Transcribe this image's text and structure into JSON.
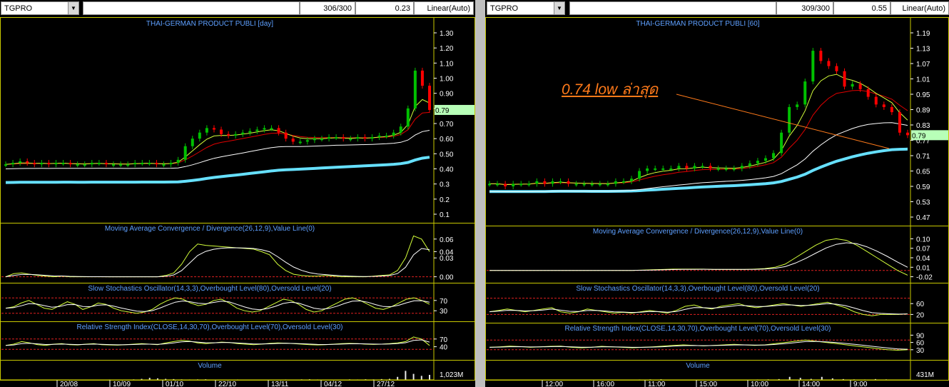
{
  "left": {
    "symbol": "TGPRO",
    "ratio": "306/300",
    "value": "0.23",
    "scale": "Linear(Auto)",
    "title": "THAI-GERMAN PRODUCT PUBLI [day]",
    "price_ticks": [
      "1.30",
      "1.20",
      "1.10",
      "1.00",
      "0.90",
      "0.80",
      "0.70",
      "0.60",
      "0.50",
      "0.40",
      "0.3",
      "0.2",
      "0.1"
    ],
    "last_price": "0.79",
    "macd_title": "Moving Average Convergence / Divergence(26,12,9),Value Line(0)",
    "macd_ticks": [
      "0.06",
      "0.04",
      "0.03",
      "0.00"
    ],
    "stoch_title": "Slow Stochastics Oscillator(14,3,3),Overbought Level(80),Oversold Level(20)",
    "stoch_ticks": [
      "70",
      "30"
    ],
    "rsi_title": "Relative Strength Index(CLOSE,14,30,70),Overbought Level(70),Oversold Level(30)",
    "rsi_ticks": [
      "70",
      "40"
    ],
    "volume_title": "Volume",
    "volume_tick": "1,023M",
    "x_labels": [
      "20/08",
      "10/09",
      "01/10",
      "22/10",
      "13/11",
      "04/12",
      "27/12"
    ]
  },
  "right": {
    "symbol": "TGPRO",
    "ratio": "309/300",
    "value": "0.55",
    "scale": "Linear(Auto)",
    "title": "THAI-GERMAN PRODUCT PUBLI [60]",
    "price_ticks": [
      "1.19",
      "1.13",
      "1.07",
      "1.01",
      "0.95",
      "0.89",
      "0.83",
      "0.77",
      "0.71",
      "0.65",
      "0.59",
      "0.53",
      "0.47"
    ],
    "last_price": "0.79",
    "annotation": "0.74  low ล่าสุด",
    "macd_title": "Moving Average Convergence / Divergence(26,12,9),Value Line(0)",
    "macd_ticks": [
      "0.10",
      "0.07",
      "0.04",
      "0.01",
      "-0.02"
    ],
    "stoch_title": "Slow Stochastics Oscillator(14,3,3),Overbought Level(80),Oversold Level(20)",
    "stoch_ticks": [
      "60",
      "20"
    ],
    "rsi_title": "Relative Strength Index(CLOSE,14,30,70),Overbought Level(70),Oversold Level(30)",
    "rsi_ticks": [
      "90",
      "60",
      "30"
    ],
    "volume_title": "Volume",
    "volume_tick": "431M",
    "x_labels": [
      "12:00",
      "16:00",
      "11:00",
      "15:00",
      "10:00",
      "14:00",
      "9:00"
    ]
  },
  "colors": {
    "panel_border": "#c8c800",
    "candle_up": "#00c000",
    "candle_down": "#ff0000",
    "ma_short": "#ffffff",
    "ma_mid": "#e00000",
    "ma_long": "#ffffff",
    "ma_thick": "#66e0ff",
    "signal": "#d4ff3a",
    "level_line": "#e02020",
    "title_text": "#5ea0ff",
    "last_price_bg": "#b8ffb8",
    "annotation": "#ff7a1a"
  },
  "chart_data": [
    {
      "type": "line",
      "title": "THAI-GERMAN PRODUCT PUBLI [day]",
      "x": [
        "20/08",
        "10/09",
        "01/10",
        "22/10",
        "13/11",
        "04/12",
        "27/12"
      ],
      "series": [],
      "ylim": [
        0.1,
        1.3
      ],
      "price_closes": [
        0.43,
        0.44,
        0.45,
        0.44,
        0.43,
        0.44,
        0.43,
        0.44,
        0.44,
        0.43,
        0.43,
        0.43,
        0.44,
        0.44,
        0.43,
        0.43,
        0.43,
        0.43,
        0.44,
        0.44,
        0.44,
        0.43,
        0.43,
        0.44,
        0.46,
        0.55,
        0.6,
        0.64,
        0.67,
        0.66,
        0.63,
        0.62,
        0.63,
        0.64,
        0.65,
        0.66,
        0.67,
        0.67,
        0.64,
        0.6,
        0.58,
        0.58,
        0.59,
        0.6,
        0.6,
        0.61,
        0.61,
        0.6,
        0.6,
        0.61,
        0.6,
        0.61,
        0.62,
        0.62,
        0.64,
        0.68,
        0.8,
        1.05,
        0.95,
        0.79
      ],
      "macd": [
        0.0,
        0.005,
        0.006,
        0.004,
        0.002,
        0.001,
        0.0,
        0.001,
        0.0,
        0.0,
        0.0,
        0.0,
        0.0,
        0.0,
        0.0,
        0.0,
        0.0,
        0.0,
        0.0,
        0.0,
        0.002,
        0.006,
        0.02,
        0.04,
        0.052,
        0.05,
        0.049,
        0.048,
        0.047,
        0.046,
        0.045,
        0.044,
        0.04,
        0.035,
        0.02,
        0.01,
        0.004,
        0.002,
        0.001,
        0.001,
        0.002,
        0.001,
        0.0,
        0.0,
        0.0,
        0.0,
        0.001,
        0.002,
        0.003,
        0.01,
        0.03,
        0.065,
        0.06,
        0.04
      ],
      "stoch": [
        40,
        45,
        60,
        70,
        55,
        40,
        35,
        50,
        65,
        55,
        35,
        45,
        60,
        55,
        40,
        30,
        25,
        20,
        25,
        35,
        55,
        70,
        80,
        75,
        60,
        50,
        55,
        70,
        75,
        60,
        40,
        30,
        25,
        30,
        45,
        60,
        75,
        70,
        55,
        35,
        25,
        30,
        45,
        60,
        75,
        80,
        70,
        55,
        40,
        35,
        45,
        60,
        75,
        80,
        70,
        55
      ],
      "rsi": [
        45,
        50,
        60,
        55,
        48,
        45,
        50,
        52,
        48,
        47,
        50,
        52,
        48,
        47,
        46,
        48,
        50,
        52,
        50,
        48,
        55,
        60,
        65,
        62,
        55,
        52,
        55,
        58,
        56,
        52,
        50,
        48,
        50,
        53,
        55,
        54,
        52,
        50,
        48,
        47,
        48,
        50,
        52,
        53,
        52,
        50,
        49,
        50,
        52,
        55,
        60,
        78,
        70,
        45
      ],
      "volume": [
        0.02,
        0.03,
        0.02,
        0.04,
        0.02,
        0.01,
        0.02,
        0.03,
        0.02,
        0.02,
        0.03,
        0.02,
        0.02,
        0.04,
        0.02,
        0.03,
        0.05,
        0.1,
        0.2,
        0.15,
        0.1,
        0.08,
        0.05,
        0.04,
        0.05,
        0.06,
        0.03,
        0.02,
        0.03,
        0.04,
        0.03,
        0.02,
        0.03,
        0.02,
        0.03,
        0.04,
        0.03,
        0.05,
        0.06,
        0.04,
        0.03,
        0.02,
        0.03,
        0.05,
        0.04,
        0.06,
        0.05,
        0.08,
        0.1,
        0.3,
        0.9,
        0.6,
        0.4,
        0.5
      ]
    },
    {
      "type": "line",
      "title": "THAI-GERMAN PRODUCT PUBLI [60]",
      "x": [
        "12:00",
        "16:00",
        "11:00",
        "15:00",
        "10:00",
        "14:00",
        "9:00"
      ],
      "series": [],
      "ylim": [
        0.47,
        1.19
      ],
      "price_closes": [
        0.6,
        0.6,
        0.59,
        0.6,
        0.6,
        0.6,
        0.61,
        0.6,
        0.61,
        0.61,
        0.6,
        0.6,
        0.6,
        0.6,
        0.6,
        0.6,
        0.61,
        0.61,
        0.62,
        0.65,
        0.66,
        0.66,
        0.66,
        0.66,
        0.67,
        0.66,
        0.67,
        0.67,
        0.66,
        0.66,
        0.66,
        0.66,
        0.67,
        0.68,
        0.69,
        0.7,
        0.72,
        0.8,
        0.9,
        0.91,
        1.0,
        1.12,
        1.08,
        1.06,
        1.04,
        0.98,
        0.99,
        0.97,
        0.94,
        0.91,
        0.9,
        0.88,
        0.8,
        0.79
      ],
      "macd": [
        0.0,
        0.0,
        0.0,
        0.0,
        0.0,
        0.0,
        0.0,
        0.0,
        0.0,
        0.0,
        0.0,
        0.0,
        0.0,
        0.0,
        0.0,
        0.001,
        0.002,
        0.003,
        0.004,
        0.004,
        0.004,
        0.004,
        0.003,
        0.003,
        0.003,
        0.003,
        0.004,
        0.006,
        0.01,
        0.02,
        0.04,
        0.06,
        0.08,
        0.095,
        0.1,
        0.095,
        0.08,
        0.06,
        0.04,
        0.02,
        0.0,
        -0.015
      ],
      "stoch": [
        30,
        35,
        40,
        35,
        30,
        35,
        40,
        45,
        30,
        25,
        30,
        40,
        35,
        30,
        25,
        28,
        25,
        30,
        35,
        30,
        25,
        35,
        50,
        55,
        45,
        40,
        50,
        55,
        60,
        50,
        45,
        50,
        55,
        60,
        55,
        50,
        55,
        60,
        65,
        55,
        45,
        30,
        20,
        15,
        20,
        20,
        20,
        22
      ],
      "rsi": [
        40,
        42,
        45,
        43,
        40,
        42,
        44,
        45,
        40,
        38,
        40,
        44,
        42,
        40,
        38,
        40,
        42,
        45,
        48,
        50,
        48,
        46,
        48,
        50,
        52,
        50,
        48,
        50,
        55,
        60,
        65,
        70,
        65,
        60,
        55,
        50,
        45,
        40,
        35,
        30,
        28,
        30
      ],
      "volume": [
        0.02,
        0.02,
        0.03,
        0.02,
        0.02,
        0.02,
        0.03,
        0.02,
        0.02,
        0.02,
        0.02,
        0.03,
        0.02,
        0.02,
        0.04,
        0.05,
        0.06,
        0.03,
        0.03,
        0.02,
        0.02,
        0.03,
        0.02,
        0.02,
        0.03,
        0.04,
        0.05,
        0.08,
        0.3,
        0.2,
        0.1,
        0.3,
        0.15,
        0.08,
        0.05,
        0.04,
        0.08,
        0.05,
        0.03,
        0.02
      ]
    }
  ]
}
